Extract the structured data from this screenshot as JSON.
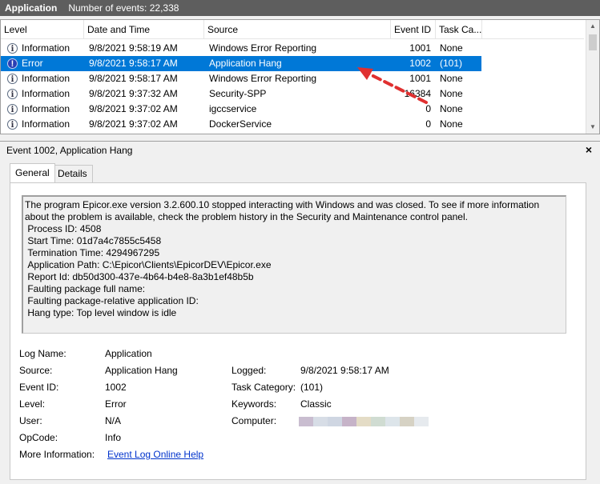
{
  "titlebar": {
    "title": "Application",
    "count_text": "Number of events: 22,338"
  },
  "list": {
    "columns": [
      "Level",
      "Date and Time",
      "Source",
      "Event ID",
      "Task Ca..."
    ],
    "rows": [
      {
        "level": "Information",
        "icon": "info-icon",
        "datetime": "9/8/2021 9:58:19 AM",
        "source": "Windows Error Reporting",
        "event_id": "1001",
        "task": "None",
        "selected": false
      },
      {
        "level": "Error",
        "icon": "error-icon",
        "datetime": "9/8/2021 9:58:17 AM",
        "source": "Application Hang",
        "event_id": "1002",
        "task": "(101)",
        "selected": true
      },
      {
        "level": "Information",
        "icon": "info-icon",
        "datetime": "9/8/2021 9:58:17 AM",
        "source": "Windows Error Reporting",
        "event_id": "1001",
        "task": "None",
        "selected": false
      },
      {
        "level": "Information",
        "icon": "info-icon",
        "datetime": "9/8/2021 9:37:32 AM",
        "source": "Security-SPP",
        "event_id": "16384",
        "task": "None",
        "selected": false
      },
      {
        "level": "Information",
        "icon": "info-icon",
        "datetime": "9/8/2021 9:37:02 AM",
        "source": "igccservice",
        "event_id": "0",
        "task": "None",
        "selected": false
      },
      {
        "level": "Information",
        "icon": "info-icon",
        "datetime": "9/8/2021 9:37:02 AM",
        "source": "DockerService",
        "event_id": "0",
        "task": "None",
        "selected": false
      }
    ]
  },
  "details": {
    "title": "Event 1002, Application Hang",
    "close_glyph": "×",
    "tabs": [
      "General",
      "Details"
    ],
    "message": "The program Epicor.exe version 3.2.600.10 stopped interacting with Windows and was closed. To see if more information about the problem is available, check the problem history in the Security and Maintenance control panel.\n Process ID: 4508\n Start Time: 01d7a4c7855c5458\n Termination Time: 4294967295\n Application Path: C:\\Epicor\\Clients\\EpicorDEV\\Epicor.exe\n Report Id: db50d300-437e-4b64-b4e8-8a3b1ef48b5b\n Faulting package full name: \n Faulting package-relative application ID: \n Hang type: Top level window is idle",
    "props": {
      "log_name_label": "Log Name:",
      "log_name": "Application",
      "source_label": "Source:",
      "source": "Application Hang",
      "logged_label": "Logged:",
      "logged": "9/8/2021 9:58:17 AM",
      "event_id_label": "Event ID:",
      "event_id": "1002",
      "task_category_label": "Task Category:",
      "task_category": "(101)",
      "level_label": "Level:",
      "level": "Error",
      "keywords_label": "Keywords:",
      "keywords": "Classic",
      "user_label": "User:",
      "user": "N/A",
      "computer_label": "Computer:",
      "opcode_label": "OpCode:",
      "opcode": "Info",
      "more_info_label": "More Information:",
      "more_info_link": "Event Log Online Help"
    }
  },
  "colors": {
    "selection": "#0078d7",
    "title_bar": "#5e5e5e",
    "link": "#0033cc",
    "annotation": "#e03030"
  }
}
